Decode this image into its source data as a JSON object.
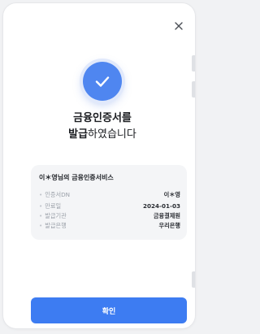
{
  "dialog": {
    "title_line1": "금융인증서를",
    "title_line2_bold": "발급",
    "title_line2_rest": "하였습니다",
    "close_icon": "close-icon",
    "status_icon": "check-circle-icon"
  },
  "certificate": {
    "heading": "이＊영님의 금융인증서비스",
    "rows": [
      {
        "key": "인증서DN",
        "value": "이＊영"
      },
      {
        "key": "만료일",
        "value": "2024-01-03"
      },
      {
        "key": "발급기관",
        "value": "금융결제원"
      },
      {
        "key": "발급은행",
        "value": "우리은행"
      }
    ]
  },
  "actions": {
    "confirm_label": "확인"
  },
  "colors": {
    "accent": "#3d7cf2",
    "check_circle": "#4f86f0",
    "card_bg": "#f4f5f7",
    "page_bg": "#f1f2f4"
  }
}
